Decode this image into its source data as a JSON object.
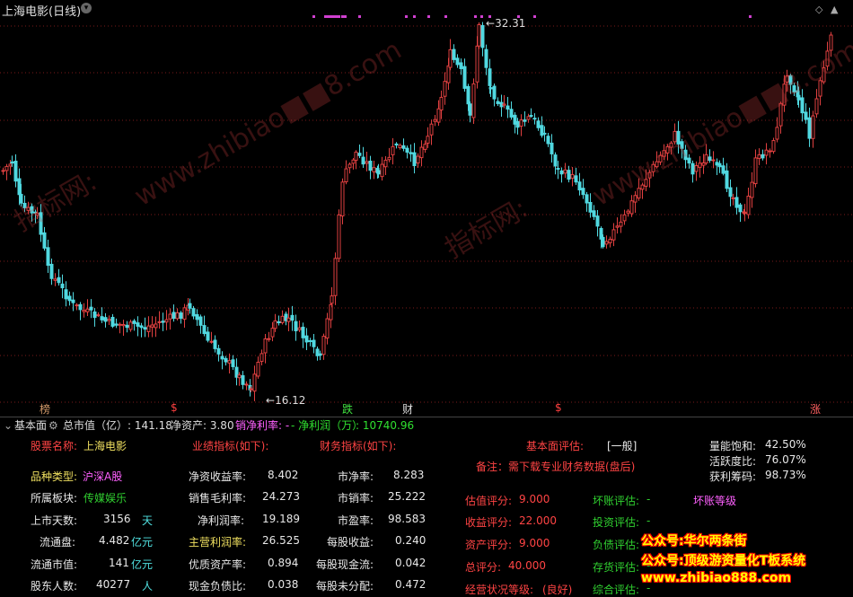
{
  "header": {
    "title": "上海电影(日线)",
    "dropdown_icon": "chevron-down-icon"
  },
  "chart": {
    "high_label": "32.31",
    "low_label": "16.12",
    "up_color": "#e04040",
    "down_color": "#50d8e0"
  },
  "markers": {
    "bang": "榜",
    "d1": "$",
    "die": "跌",
    "cai": "财",
    "d2": "$",
    "zhang": "涨"
  },
  "info_bar": {
    "prefix": "基本面",
    "mcap": "总市值（亿）: 141.18",
    "net_assets": "净资产: 3.80",
    "margin_label": "销净利率: -",
    "profit_label": "净利润（万）",
    "profit_value": ": 10740.96"
  },
  "panel": {
    "stock_name_label": "股票名称:",
    "stock_name": "上海电影",
    "perf_header": "业绩指标(如下):",
    "fin_header": "财务指标(如下):",
    "fund_eval_label": "基本面评估:",
    "fund_eval_value": "[一般]",
    "note": "备注：需下载专业财务数据(盘后)",
    "vol_sat_label": "量能饱和:",
    "vol_sat": "42.50%",
    "activity_label": "活跃度比:",
    "activity": "76.07%",
    "profit_chips_label": "获利筹码:",
    "profit_chips": "98.73%",
    "type_label": "品种类型:",
    "type": "沪深A股",
    "sector_label": "所属板块:",
    "sector": "传媒娱乐",
    "days_label": "上市天数:",
    "days": "3156",
    "days_unit": "天",
    "float_label": "流通盘:",
    "float": "4.482",
    "float_unit": "亿元",
    "float_mcap_label": "流通市值:",
    "float_mcap": "141",
    "float_mcap_unit": "亿元",
    "holders_label": "股东人数:",
    "holders": "40277",
    "holders_unit": "人",
    "roe_label": "净资收益率:",
    "roe": "8.402",
    "gross_label": "销售毛利率:",
    "gross": "24.273",
    "net_label": "净利润率:",
    "net": "19.189",
    "main_label": "主营利润率:",
    "main": "26.525",
    "roa_label": "优质资产率:",
    "roa": "0.894",
    "cash_debt_label": "现金负债比:",
    "cash_debt": "0.038",
    "pb_label": "市净率:",
    "pb": "8.283",
    "ps_label": "市销率:",
    "ps": "25.222",
    "pe_label": "市盈率:",
    "pe": "98.583",
    "eps_label": "每股收益:",
    "eps": "0.240",
    "cfps_label": "每股现金流:",
    "cfps": "0.042",
    "undist_label": "每股未分配:",
    "undist": "0.472",
    "val_score_label": "估值评分:",
    "val_score": "9.000",
    "earn_score_label": "收益评分:",
    "earn_score": "22.000",
    "asset_score_label": "资产评分:",
    "asset_score": "9.000",
    "total_score_label": "总评分:",
    "total_score": "40.000",
    "op_grade_label": "经营状况等级:",
    "op_grade": "(良好)",
    "bad_debt_label": "坏账评估:",
    "bad_debt": "-",
    "invest_label": "投资评估:",
    "invest": "-",
    "liab_label": "负债评估:",
    "liab": "-",
    "stock_label": "存货评估:",
    "stock": "-",
    "overall_label": "综合评估:",
    "overall": "-",
    "bad_grade_label": "坏账等级",
    "promo1": "公众号:华尔两条街",
    "promo2": "公众号:顶级游资量化T板系统",
    "promo3": "www.zhibiao888.com"
  },
  "watermark": {
    "text1": "www.zhibiao",
    "text2": "8.com",
    "text3": "指标网:"
  }
}
